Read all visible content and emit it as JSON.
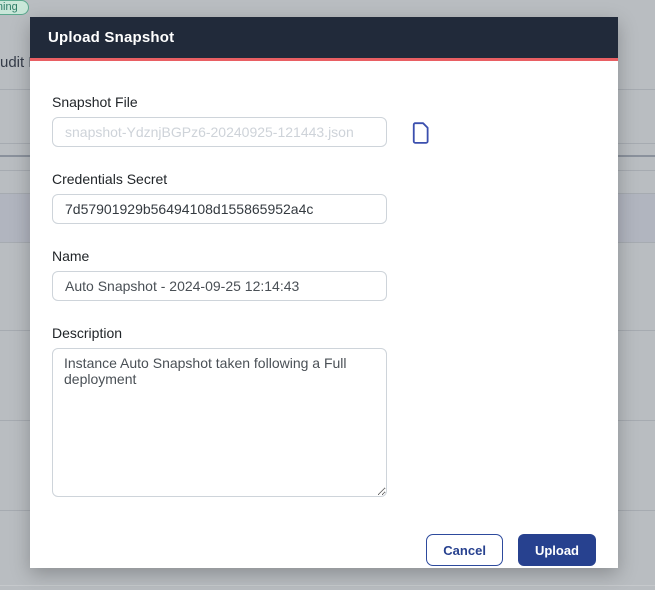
{
  "colors": {
    "page-bg": "#b9bdc1",
    "header-bg": "#212a3a",
    "accent-red": "#e95f63",
    "primary-navy": "#27418f",
    "input-border": "#ced4da",
    "placeholder": "#ced3d9",
    "label-text": "#212529",
    "input-text": "#4a5056",
    "file-icon-blue": "#3b4fae",
    "badge-green-bg": "#c9e7d9",
    "badge-green-text": "#2f7d68",
    "row-line": "#a6abb1",
    "selected-row": "#b1b5bf"
  },
  "background": {
    "status_badge": "running",
    "partial_text": "udit L"
  },
  "modal": {
    "title": "Upload Snapshot",
    "snapshot_file": {
      "label": "Snapshot File",
      "placeholder": "snapshot-YdznjBGPz6-20240925-121443.json",
      "icon": "file-icon"
    },
    "credentials_secret": {
      "label": "Credentials Secret",
      "value": "7d57901929b56494108d155865952a4c"
    },
    "name": {
      "label": "Name",
      "value": "Auto Snapshot - 2024-09-25 12:14:43"
    },
    "description": {
      "label": "Description",
      "value": "Instance Auto Snapshot taken following a Full deployment"
    },
    "buttons": {
      "cancel": "Cancel",
      "upload": "Upload"
    }
  }
}
